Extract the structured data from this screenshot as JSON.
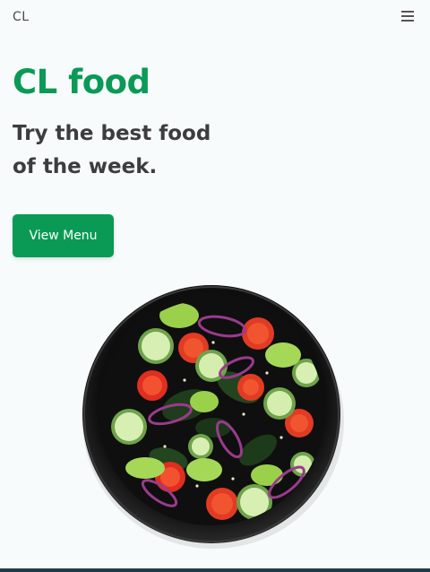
{
  "header": {
    "brand": "CL",
    "menu_icon": "hamburger-menu-icon"
  },
  "hero": {
    "title": "CL food",
    "subtitle": "Try the best food of the week.",
    "cta_label": "View Menu"
  },
  "image": {
    "subject": "salad bowl"
  },
  "colors": {
    "accent": "#0a9a55",
    "background": "#f7fbfb",
    "text": "#3d3d3d",
    "footer_line": "#223a46"
  }
}
